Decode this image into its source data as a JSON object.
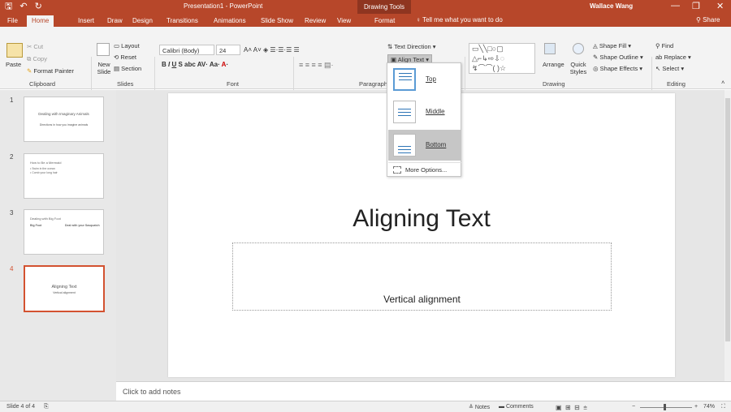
{
  "titlebar": {
    "save_icon": "save-icon",
    "undo_icon": "undo-icon",
    "redo_icon": "redo-icon",
    "document_title": "Presentation1 - PowerPoint",
    "context_tab": "Drawing Tools",
    "user_name": "Wallace Wang",
    "minimize": "—",
    "restore": "❐",
    "close": "✕"
  },
  "tabs": [
    "File",
    "Home",
    "Insert",
    "Draw",
    "Design",
    "Transitions",
    "Animations",
    "Slide Show",
    "Review",
    "View",
    "Format"
  ],
  "active_tab": "Home",
  "tell_me": "Tell me what you want to do",
  "share": "Share",
  "ribbon": {
    "clipboard": {
      "paste": "Paste",
      "cut": "Cut",
      "copy": "Copy",
      "format_painter": "Format Painter",
      "label": "Clipboard"
    },
    "slides": {
      "new_slide": "New Slide",
      "layout": "Layout",
      "reset": "Reset",
      "section": "Section",
      "label": "Slides"
    },
    "font": {
      "font_name": "Calibri (Body)",
      "font_size": "24",
      "label": "Font"
    },
    "paragraph": {
      "text_direction": "Text Direction",
      "align_text": "Align Text",
      "label": "Paragraph"
    },
    "drawing": {
      "arrange": "Arrange",
      "quick_styles": "Quick Styles",
      "shape_fill": "Shape Fill",
      "shape_outline": "Shape Outline",
      "shape_effects": "Shape Effects",
      "label": "Drawing"
    },
    "editing": {
      "find": "Find",
      "replace": "Replace",
      "select": "Select",
      "label": "Editing"
    }
  },
  "align_menu": {
    "items": [
      {
        "label": "Top",
        "selected": false
      },
      {
        "label": "Middle",
        "selected": false
      },
      {
        "label": "Bottom",
        "selected": true
      }
    ],
    "more_options": "More Options..."
  },
  "thumbnails": [
    {
      "number": "1",
      "title": "Dealing with Imaginary Animals",
      "subtitle": "Directions in how you imagine animals"
    },
    {
      "number": "2",
      "title": "How to Be a Mermaid",
      "bullets": [
        "• Swim in the ocean",
        "• Comb your long hair"
      ]
    },
    {
      "number": "3",
      "title": "Dealing with Big Foot",
      "col1": "Big Foot",
      "col2": "Deal with your Sasquatch"
    },
    {
      "number": "4",
      "title": "Aligning Text",
      "subtitle": "Vertical alignment",
      "selected": true
    }
  ],
  "slide": {
    "title": "Aligning Text",
    "textbox": "Vertical alignment"
  },
  "notes_placeholder": "Click to add notes",
  "status": {
    "slide_of": "Slide 4 of 4",
    "notes": "Notes",
    "comments": "Comments",
    "zoom": "74%"
  },
  "colors": {
    "accent": "#b7472a",
    "selection": "#d35230"
  }
}
